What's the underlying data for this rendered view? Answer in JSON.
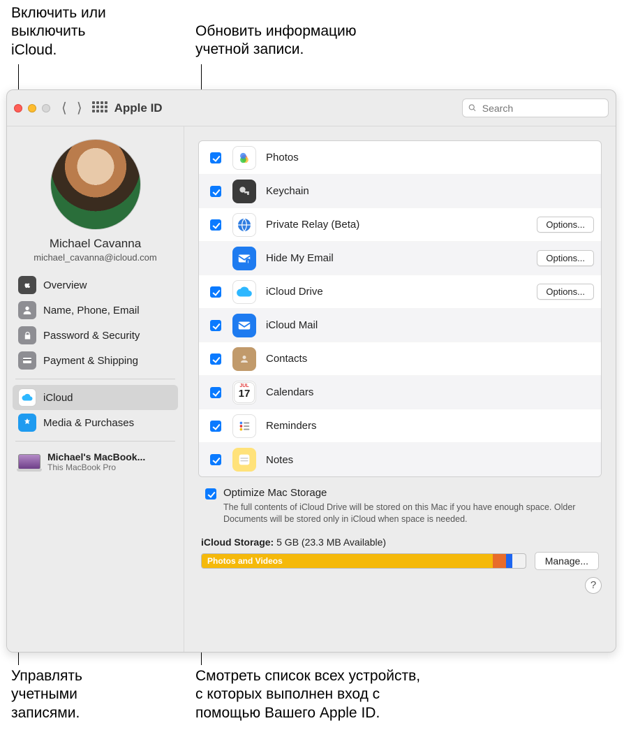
{
  "callouts": {
    "top_left": "Включить или\nвыключить\niCloud.",
    "top_right": "Обновить информацию\nучетной записи.",
    "bottom_left": "Управлять\nучетными\nзаписями.",
    "bottom_right": "Смотреть список всех устройств,\nс которых выполнен вход с\nпомощью Вашего Apple ID."
  },
  "window": {
    "title": "Apple ID",
    "search_placeholder": "Search"
  },
  "user": {
    "name": "Michael Cavanna",
    "email": "michael_cavanna@icloud.com"
  },
  "sidebar": {
    "items": [
      {
        "label": "Overview",
        "icon": "",
        "bg": "#4a4a4a"
      },
      {
        "label": "Name, Phone, Email",
        "icon": "person",
        "bg": "#8e8e93"
      },
      {
        "label": "Password & Security",
        "icon": "lock",
        "bg": "#8e8e93"
      },
      {
        "label": "Payment & Shipping",
        "icon": "card",
        "bg": "#8e8e93"
      }
    ],
    "items2": [
      {
        "label": "iCloud",
        "icon": "cloud",
        "bg": "#ffffff",
        "selected": true
      },
      {
        "label": "Media & Purchases",
        "icon": "appstore",
        "bg": "#1e9bf0"
      }
    ],
    "device": {
      "name": "Michael's MacBook...",
      "sub": "This MacBook Pro"
    }
  },
  "services": [
    {
      "checked": true,
      "label": "Photos",
      "icon_bg": "#ffffff",
      "icon": "photos"
    },
    {
      "checked": true,
      "label": "Keychain",
      "icon_bg": "#3a3a3a",
      "icon": "keychain"
    },
    {
      "checked": true,
      "label": "Private Relay (Beta)",
      "icon_bg": "#ffffff",
      "icon": "relay",
      "options": true
    },
    {
      "checked": null,
      "label": "Hide My Email",
      "icon_bg": "#1e7bf0",
      "icon": "hidemail",
      "options": true
    },
    {
      "checked": true,
      "label": "iCloud Drive",
      "icon_bg": "#ffffff",
      "icon": "clouddrive",
      "options": true
    },
    {
      "checked": true,
      "label": "iCloud Mail",
      "icon_bg": "#1e7bf0",
      "icon": "mail"
    },
    {
      "checked": true,
      "label": "Contacts",
      "icon_bg": "#c19a6b",
      "icon": "contacts"
    },
    {
      "checked": true,
      "label": "Calendars",
      "icon_bg": "#ffffff",
      "icon": "calendar",
      "cal": "17"
    },
    {
      "checked": true,
      "label": "Reminders",
      "icon_bg": "#ffffff",
      "icon": "reminders"
    },
    {
      "checked": true,
      "label": "Notes",
      "icon_bg": "#ffe27a",
      "icon": "notes"
    }
  ],
  "options_label": "Options...",
  "optimize": {
    "title": "Optimize Mac Storage",
    "desc": "The full contents of iCloud Drive will be stored on this Mac if you have enough space. Older Documents will be stored only in iCloud when space is needed."
  },
  "storage": {
    "label_prefix": "iCloud Storage:",
    "label_value": "5 GB (23.3 MB Available)",
    "bar_segment_label": "Photos and Videos",
    "segments": [
      {
        "color": "#f5b90a",
        "start": 0,
        "end": 90
      },
      {
        "color": "#e86c2a",
        "start": 90,
        "end": 94
      },
      {
        "color": "#1e66f0",
        "start": 94,
        "end": 96
      }
    ],
    "manage_label": "Manage..."
  },
  "help_label": "?"
}
